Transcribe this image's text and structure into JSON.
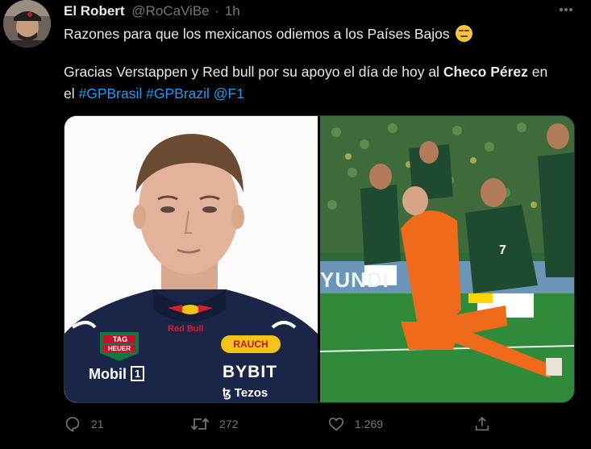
{
  "tweet": {
    "author_name": "El Robert",
    "author_handle": "@RoCaViBe",
    "separator": "·",
    "time": "1h",
    "line1": "Razones para que los mexicanos odiemos a los Países Bajos",
    "line1_emoji": "expressionless-face-emoji",
    "line2_a": "Gracias Verstappen y Red bull por su apoyo el día de hoy al ",
    "line2_bold": "Checo Pérez",
    "line2_c": " en",
    "line3_a": "el ",
    "hashtag1": "#GPBrasil",
    "hashtag2": "#GPBrazil",
    "mention": "@F1"
  },
  "media": {
    "left_logos": {
      "tag": "TAG",
      "heuer": "HEUER",
      "redbull": "Red Bull",
      "rauch": "RAUCH",
      "mobil": "Mobil",
      "mobil_num": "1",
      "bybit": "BYBIT",
      "tezos": "ꜩ Tezos"
    },
    "right_banner": "YUNDI",
    "right_jersey_number": "7"
  },
  "actions": {
    "reply_count": "21",
    "retweet_count": "272",
    "like_count": "1.269"
  },
  "colors": {
    "background": "#000000",
    "text": "#e7e9ea",
    "secondary": "#71767b",
    "link": "#1d9bf0"
  }
}
